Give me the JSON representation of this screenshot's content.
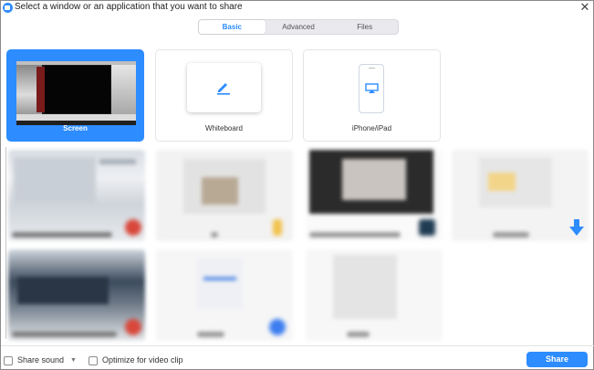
{
  "window": {
    "title": "Select a window or an application that you want to share",
    "close_glyph": "✕"
  },
  "tabs": [
    {
      "label": "Basic",
      "active": true
    },
    {
      "label": "Advanced",
      "active": false
    },
    {
      "label": "Files",
      "active": false
    }
  ],
  "share_options": {
    "screen_label": "Screen",
    "whiteboard_label": "Whiteboard",
    "iphone_label": "iPhone/iPad"
  },
  "footer": {
    "share_sound_label": "Share sound",
    "optimize_label": "Optimize for video clip",
    "share_button": "Share"
  },
  "colors": {
    "accent": "#2d8cff"
  },
  "icons": [
    "zoom-app-icon",
    "close-icon",
    "pen-icon",
    "airplay-icon",
    "chevron-down-icon",
    "download-arrow-icon"
  ]
}
